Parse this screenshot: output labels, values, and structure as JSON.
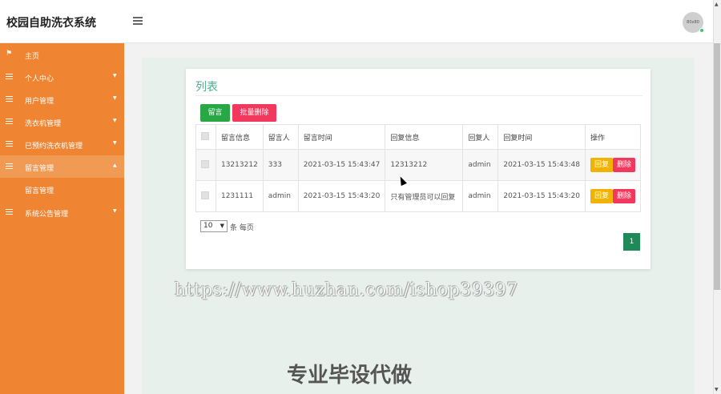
{
  "app": {
    "title": "校园自助洗衣系统",
    "avatar_text": "80x80"
  },
  "sidebar": {
    "items": [
      {
        "label": "主页"
      },
      {
        "label": "个人中心"
      },
      {
        "label": "用户管理"
      },
      {
        "label": "洗衣机管理"
      },
      {
        "label": "已预约洗衣机管理"
      },
      {
        "label": "留言管理"
      },
      {
        "label": "系统公告管理"
      }
    ],
    "sub_item": "留言管理"
  },
  "panel": {
    "title": "列表",
    "add_button": "留言",
    "batch_delete_button": "批量删除"
  },
  "table": {
    "headers": [
      "留言信息",
      "留言人",
      "留言时间",
      "回复信息",
      "回复人",
      "回复时间",
      "操作"
    ],
    "rows": [
      {
        "message": "13213212",
        "author": "333",
        "time": "2021-03-15 15:43:47",
        "reply": "12313212",
        "replier": "admin",
        "reply_time": "2021-03-15 15:43:48"
      },
      {
        "message": "1231111",
        "author": "admin",
        "time": "2021-03-15 15:43:20",
        "reply": "只有管理员可以回复",
        "replier": "admin",
        "reply_time": "2021-03-15 15:43:20"
      }
    ],
    "reply_label": "回复",
    "delete_label": "删除"
  },
  "pager": {
    "page_size": "10",
    "suffix": "条 每页",
    "current_page": "1"
  },
  "watermark": {
    "url": "https://www.huzhan.com/ishop39397",
    "slogan": "专业毕设代做"
  },
  "colors": {
    "sidebar": "#ef8533",
    "accent": "#4caf8e",
    "add": "#28a745",
    "danger": "#f2385c",
    "reply": "#f0b400",
    "page": "#1d8a58"
  }
}
